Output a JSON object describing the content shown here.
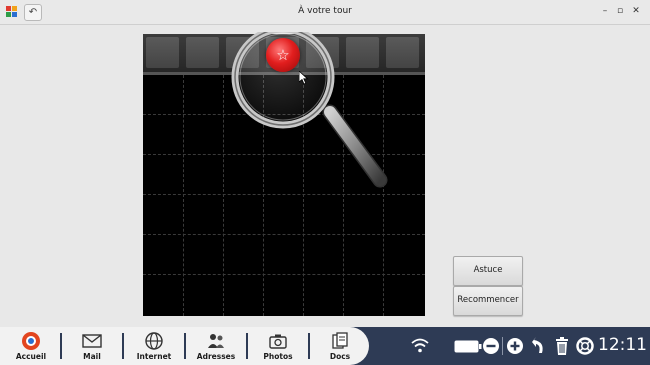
{
  "window": {
    "title": "À votre tour",
    "back_icon": "back-arrow-icon",
    "controls": {
      "minimize": "–",
      "maximize": "▫",
      "close": "✕"
    }
  },
  "game": {
    "token_icon": "star-icon",
    "token_symbol": "☆",
    "token_color": "#e21e1e",
    "tool_icon": "magnifier-icon"
  },
  "buttons": {
    "hint": "Astuce",
    "restart": "Recommencer"
  },
  "dock": {
    "items": [
      {
        "label": "Accueil",
        "icon": "home-icon"
      },
      {
        "label": "Mail",
        "icon": "mail-icon"
      },
      {
        "label": "Internet",
        "icon": "globe-icon"
      },
      {
        "label": "Adresses",
        "icon": "contacts-icon"
      },
      {
        "label": "Photos",
        "icon": "camera-icon"
      },
      {
        "label": "Docs",
        "icon": "documents-icon"
      }
    ]
  },
  "system_tray": {
    "icons": [
      "wifi-icon",
      "battery-icon",
      "zoom-out-icon",
      "zoom-in-icon",
      "back-icon",
      "trash-icon",
      "help-icon"
    ],
    "clock": "12:11"
  },
  "colors": {
    "taskbar": "#2e3b55",
    "board": "#000000"
  }
}
